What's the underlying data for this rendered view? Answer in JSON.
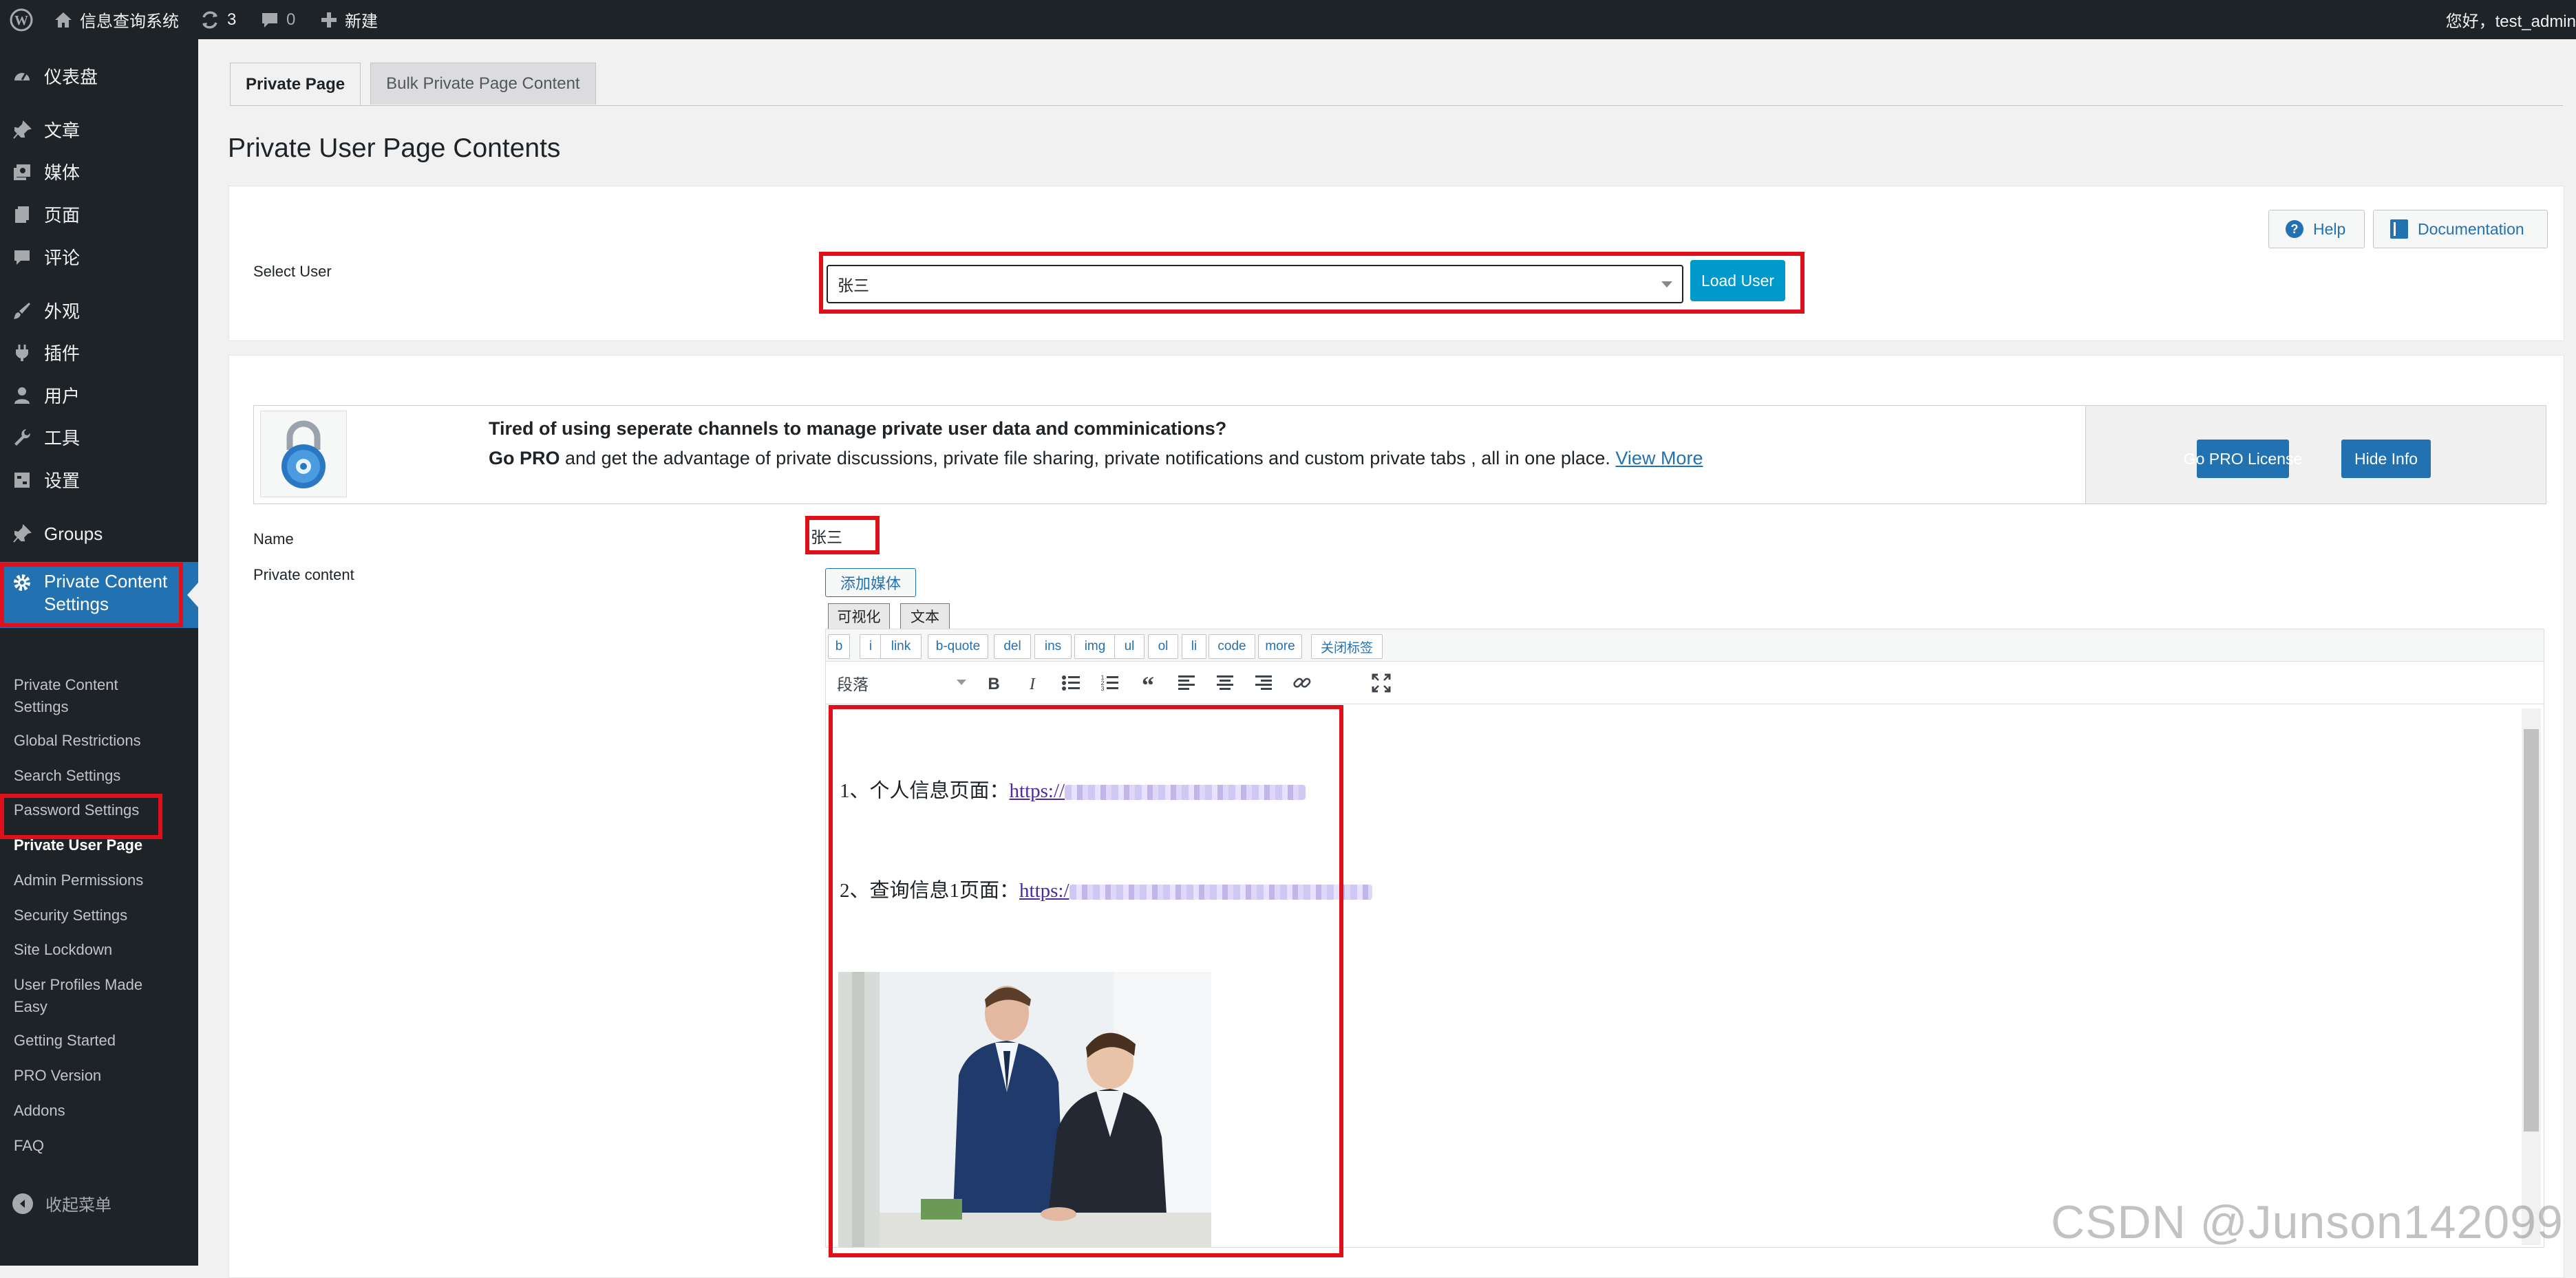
{
  "adminbar": {
    "site_name": "信息查询系统",
    "updates_count": "3",
    "comments_count": "0",
    "new_label": "新建",
    "greeting": "您好，test_admin"
  },
  "sidebar": {
    "items": [
      {
        "label": "仪表盘",
        "icon": "dashboard-icon"
      },
      {
        "label": "文章",
        "icon": "pin-icon"
      },
      {
        "label": "媒体",
        "icon": "media-icon"
      },
      {
        "label": "页面",
        "icon": "page-icon"
      },
      {
        "label": "评论",
        "icon": "comment-icon"
      },
      {
        "label": "外观",
        "icon": "brush-icon"
      },
      {
        "label": "插件",
        "icon": "plugin-icon"
      },
      {
        "label": "用户",
        "icon": "user-icon"
      },
      {
        "label": "工具",
        "icon": "wrench-icon"
      },
      {
        "label": "设置",
        "icon": "settings-icon"
      },
      {
        "label": "Groups",
        "icon": "pin-icon"
      }
    ],
    "current_menu": {
      "label_line1": "Private Content",
      "label_line2": "Settings",
      "icon": "gear-icon"
    },
    "submenu": [
      {
        "label": "Private Content Settings"
      },
      {
        "label": "Global Restrictions"
      },
      {
        "label": "Search Settings"
      },
      {
        "label": "Password Settings"
      },
      {
        "label": "Private User Page"
      },
      {
        "label": "Admin Permissions"
      },
      {
        "label": "Security Settings"
      },
      {
        "label": "Site Lockdown"
      },
      {
        "label": "User Profiles Made Easy"
      },
      {
        "label": "Getting Started"
      },
      {
        "label": "PRO Version"
      },
      {
        "label": "Addons"
      },
      {
        "label": "FAQ"
      }
    ],
    "collapse_label": "收起菜单"
  },
  "tabs": [
    {
      "label": "Private Page"
    },
    {
      "label": "Bulk Private Page Content"
    }
  ],
  "page_title": "Private User Page Contents",
  "help": {
    "help_label": "Help",
    "doc_label": "Documentation"
  },
  "select_user": {
    "label": "Select User",
    "selected_value": "张三",
    "load_button": "Load User"
  },
  "promo": {
    "title": "Tired of using seperate channels to manage private user data and comminications?",
    "text_bold": "Go PRO",
    "text": " and get the advantage of private discussions, private file sharing, private notifications and custom private tabs , all in one place. ",
    "link": "View More",
    "gopro_button": "Go PRO License",
    "hide_button": "Hide Info"
  },
  "name_field": {
    "label": "Name",
    "value": "张三"
  },
  "editor": {
    "label": "Private content",
    "add_media": "添加媒体",
    "tab_visual": "可视化",
    "tab_text": "文本",
    "quicktags": [
      "b",
      "i",
      "link",
      "b-quote",
      "del",
      "ins",
      "img",
      "ul",
      "ol",
      "li",
      "code",
      "more",
      "关闭标签"
    ],
    "format_select": "段落",
    "line1_prefix": "1、个人信息页面：",
    "line1_link": "https://",
    "line2_prefix": "2、查询信息1页面：",
    "line2_link": "https:/"
  },
  "watermark": "CSDN @Junson142099",
  "colors": {
    "accent": "#2271b1",
    "highlight": "#e0101b",
    "load_button": "#0099cc",
    "adminbar": "#1d2327"
  }
}
